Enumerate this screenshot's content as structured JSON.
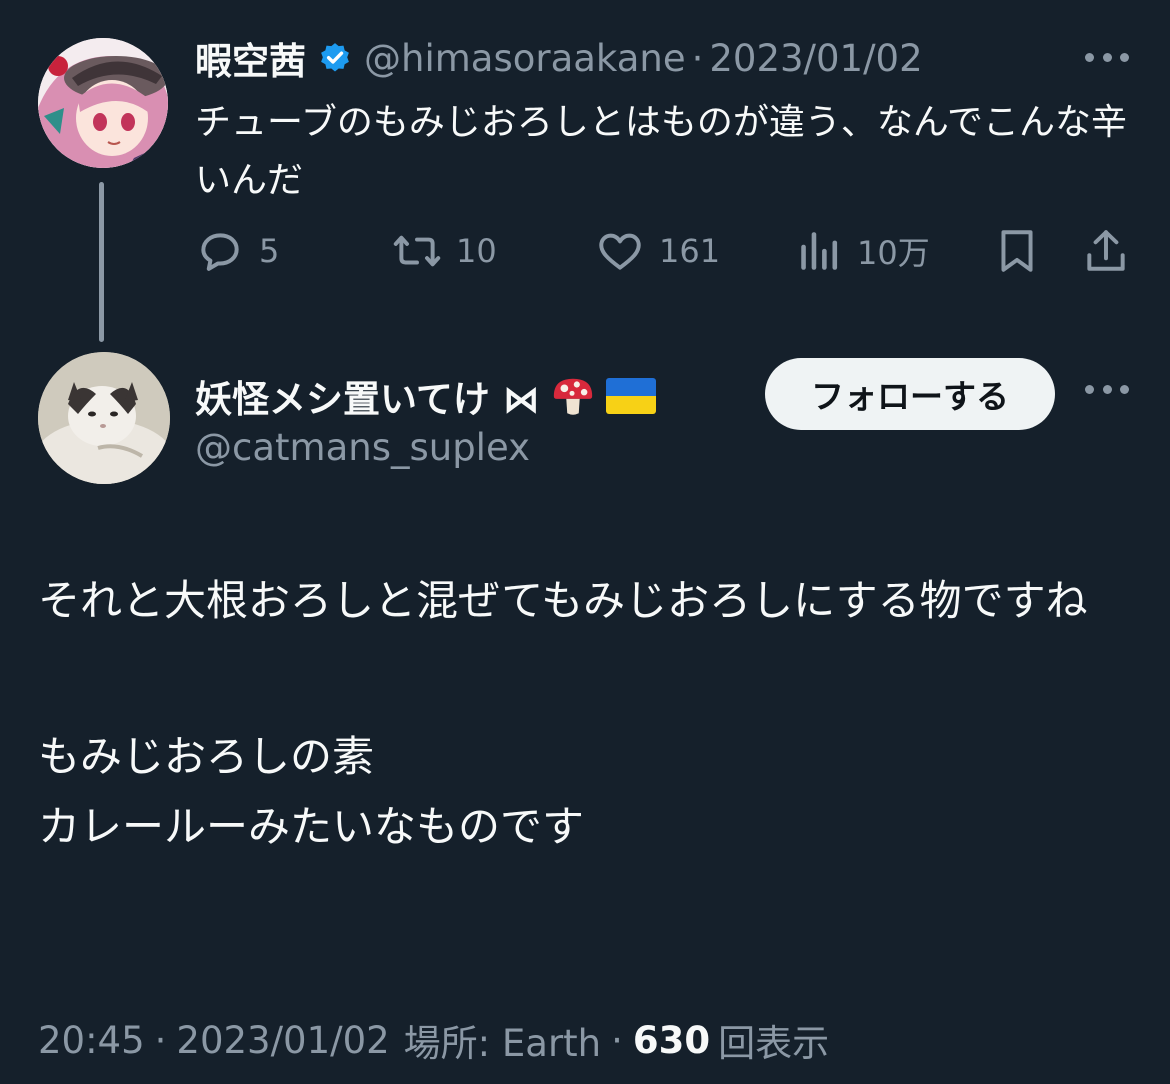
{
  "tweet1": {
    "display_name": "暇空茜",
    "handle": "@himasoraakane",
    "separator": "·",
    "date": "2023/01/02",
    "text": "チューブのもみじおろしとはものが違う、なんでこんな辛いんだ",
    "replies": "5",
    "retweets": "10",
    "likes": "161",
    "views": "10万",
    "verified_color": "#1d9bf0"
  },
  "reply": {
    "display_name": "妖怪メシ置いてけ ⋈",
    "handle": "@catmans_suplex",
    "follow_label": "フォローする",
    "paragraphs": [
      "それと大根おろしと混ぜてもみじおろしにする物ですね",
      "もみじおろしの素",
      "カレールーみたいなものです"
    ],
    "emoji_icons": [
      "mushroom-icon",
      "ukraine-flag-icon"
    ]
  },
  "meta": {
    "time": "20:45",
    "separator": "·",
    "date": "2023/01/02",
    "location": "場所: Earth",
    "view_count": "630",
    "views_label": "回表示"
  },
  "colors": {
    "background": "#15202b",
    "text": "#f7f9f9",
    "muted": "#8b98a5",
    "accent": "#1d9bf0"
  }
}
